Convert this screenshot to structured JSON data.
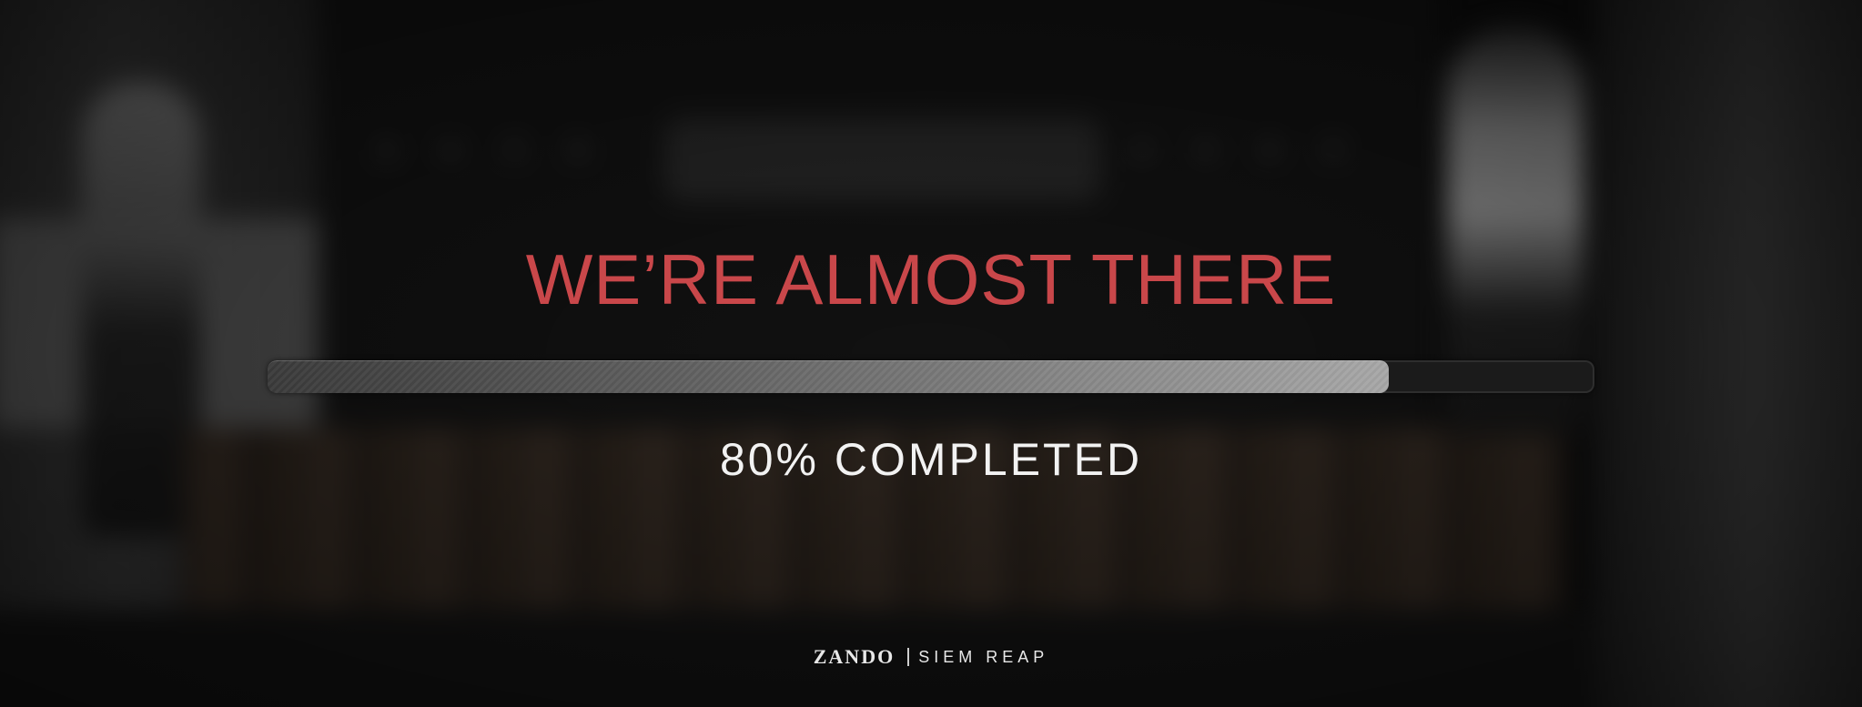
{
  "headline": "WE’RE ALMOST THERE",
  "progress": {
    "percent": 80,
    "label": "80% COMPLETED"
  },
  "footer": {
    "brand": "ZANDO",
    "location": "SIEM REAP"
  },
  "colors": {
    "headline": "#c9474a",
    "progress_fill_end": "#a8a8a8",
    "progress_track": "#1b1b1b",
    "label": "#f2f2f2"
  }
}
